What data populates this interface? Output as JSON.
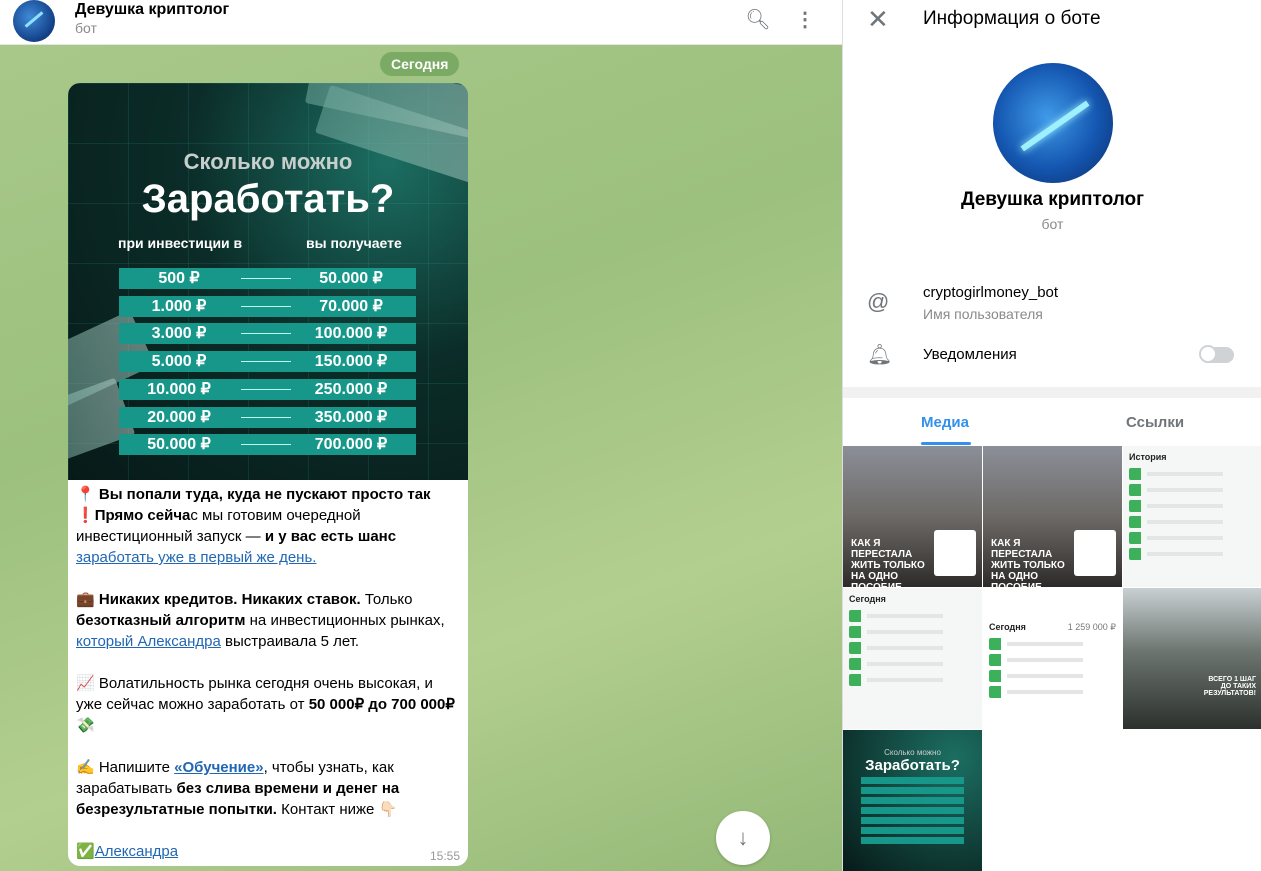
{
  "chat": {
    "title": "Девушка криптолог",
    "subtitle": "бот",
    "date_pill": "Сегодня",
    "icons": {
      "search": "search-icon",
      "menu": "more-vertical-icon",
      "scroll": "arrow-down-icon"
    }
  },
  "promo": {
    "title_line1": "Сколько можно",
    "title_line2": "Заработать?",
    "col_invest": "при инвестиции в",
    "col_get": "вы получаете",
    "rows": [
      [
        "500 ₽",
        "50.000 ₽"
      ],
      [
        "1.000 ₽",
        "70.000 ₽"
      ],
      [
        "3.000 ₽",
        "100.000 ₽"
      ],
      [
        "5.000 ₽",
        "150.000 ₽"
      ],
      [
        "10.000 ₽",
        "250.000 ₽"
      ],
      [
        "20.000 ₽",
        "350.000 ₽"
      ],
      [
        "50.000 ₽",
        "700.000 ₽"
      ]
    ]
  },
  "message": {
    "paragraphs": [
      [
        {
          "t": "📍 "
        },
        {
          "t": "Вы попали туда, куда не пускают просто так",
          "b": true
        }
      ],
      [
        {
          "t": "❗"
        },
        {
          "t": "Прямо сейча",
          "b": true
        },
        {
          "t": "с мы готовим очередной инвестиционный запуск — "
        },
        {
          "t": "и у вас есть шанс",
          "b": true
        },
        {
          "t": " "
        },
        {
          "t": "заработать уже в первый же день.",
          "link": true
        }
      ],
      [],
      [
        {
          "t": "💼 "
        },
        {
          "t": "Никаких кредитов. Никаких ставок.",
          "b": true
        },
        {
          "t": " Только "
        },
        {
          "t": "безотказный алгоритм",
          "b": true
        },
        {
          "t": " на инвестиционных рынках, "
        },
        {
          "t": "который Александра",
          "link": true
        },
        {
          "t": " выстраивала 5 лет."
        }
      ],
      [],
      [
        {
          "t": "📈 Волатильность рынка сегодня очень высокая, и уже сейчас можно заработать от "
        },
        {
          "t": "50  000₽ до 700 000₽",
          "b": true
        },
        {
          "t": " 💸"
        }
      ],
      [],
      [
        {
          "t": "✍️ Напишите "
        },
        {
          "t": "«Обучение»",
          "link": true,
          "b": true
        },
        {
          "t": ", чтобы узнать, как зарабатывать "
        },
        {
          "t": "без слива времени и денег на безрезультатные попытки.",
          "b": true
        },
        {
          "t": " Контакт ниже 👇🏻"
        }
      ],
      [],
      [
        {
          "t": "✅"
        },
        {
          "t": "Александра",
          "link": true
        }
      ]
    ],
    "time": "15:55"
  },
  "panel": {
    "title": "Информация о боте",
    "name": "Девушка криптолог",
    "type": "бот",
    "username": "cryptogirlmoney_bot",
    "username_label": "Имя пользователя",
    "notifications_label": "Уведомления",
    "notifications_on": false,
    "tabs": [
      "Медиа",
      "Ссылки"
    ],
    "active_tab": "Медиа",
    "accent": "#3390ec"
  },
  "media": {
    "photo_caption": "КАК Я ПЕРЕСТАЛА ЖИТЬ ТОЛЬКО НА ОДНО ПОСОБИЕ",
    "history_label": "История",
    "today_label": "Сегодня",
    "today_total": "1 259 000 ₽",
    "result_caption": "ВСЕГО 1 ШАГ ДО ТАКИХ РЕЗУЛЬТАТОВ!",
    "promo_line1": "Сколько можно",
    "promo_line2": "Заработать?"
  }
}
